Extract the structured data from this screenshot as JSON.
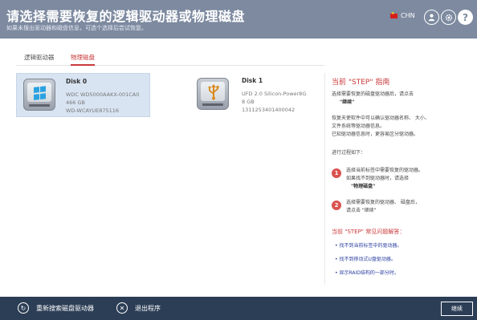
{
  "header": {
    "title": "请选择需要恢复的逻辑驱动器或物理磁盘",
    "subtitle": "如果未搜出驱动器和磁盘信息，可选个选择后尝试恢复。",
    "language": "CHN",
    "icons": [
      "user-icon",
      "gear-icon",
      "help-icon"
    ],
    "help_glyph": "?"
  },
  "tabs": [
    {
      "label": "逻辑驱动器",
      "active": false
    },
    {
      "label": "物理磁盘",
      "active": true
    }
  ],
  "disks": [
    {
      "name": "Disk 0",
      "model": "WDC WD5000AAKX-001CA0",
      "size": "466 GB",
      "serial": "WD-WCAYUE875116",
      "icon": "windows-drive-icon",
      "selected": true
    },
    {
      "name": "Disk 1",
      "model": "UFD 2.0 Silicon-Power8G",
      "size": "8 GB",
      "serial": "1311253401400042",
      "icon": "usb-drive-icon",
      "selected": false
    }
  ],
  "guide": {
    "title": "当前 \"STEP\" 指南",
    "intro_line1": "选择需要恢复的磁盘驱动器后，请点击",
    "intro_bold": "\"继续\"",
    "info_line1": "恢复天使软件中可以确认驱动器名称、 大小、",
    "info_line2": "文件系统等驱动器信息。",
    "info_line3": "已知驱动器信息时，更容易区分驱动器。",
    "process_label": "进行过程如下：",
    "steps": [
      {
        "num": "1",
        "line1": "选择当前标签中需要恢复的驱动器。",
        "line2": "如果找不到驱动器时，请选择",
        "bold": "\"物理磁盘\""
      },
      {
        "num": "2",
        "line1": "选择需要恢复的驱动器、 磁盘后，",
        "line2": "请点击 \"继续\""
      }
    ],
    "faq_title": "当前 \"STEP\" 常见问题解答：",
    "faq": [
      "找不到当前标签中的驱动器。",
      "找不到移动式U盘驱动器。",
      "显示RAID结构的一部分时。"
    ]
  },
  "footer": {
    "rescan_label": "重新搜索磁盘驱动器",
    "quit_label": "退出程序",
    "continue_label": "继续"
  },
  "colors": {
    "header_bg": "#7d8aa0",
    "footer_bg": "#2c3e56",
    "accent_red": "#c93a3a",
    "selected_bg": "#d8e4f2",
    "faq_link": "#2a3fa0"
  }
}
